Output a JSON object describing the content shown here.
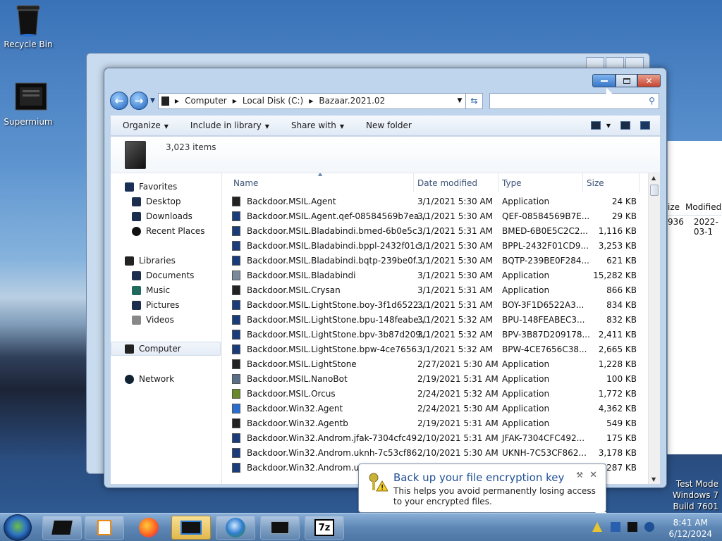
{
  "desktop": {
    "icons": [
      {
        "label": "Recycle Bin",
        "icon": "recycle-bin-icon"
      },
      {
        "label": "Supermium",
        "icon": "supermium-icon"
      }
    ]
  },
  "background_window": {
    "header_cols": [
      "ize",
      "Modified"
    ],
    "row": [
      "936",
      "2022-03-1"
    ]
  },
  "window": {
    "caption_buttons": [
      "minimize",
      "maximize",
      "close"
    ],
    "address": {
      "crumbs": [
        "Computer",
        "Local Disk (C:)",
        "Bazaar.2021.02"
      ]
    },
    "search_placeholder": "",
    "toolbar": {
      "organize": "Organize",
      "include": "Include in library",
      "share": "Share with",
      "new_folder": "New folder"
    },
    "info": {
      "count": "3,023 items"
    },
    "nav": {
      "favorites": "Favorites",
      "desktop": "Desktop",
      "downloads": "Downloads",
      "recent": "Recent Places",
      "libraries": "Libraries",
      "documents": "Documents",
      "music": "Music",
      "pictures": "Pictures",
      "videos": "Videos",
      "computer": "Computer",
      "network": "Network"
    },
    "columns": {
      "name": "Name",
      "date": "Date modified",
      "type": "Type",
      "size": "Size"
    },
    "files": [
      {
        "name": "Backdoor.MSIL.Agent",
        "date": "3/1/2021 5:30 AM",
        "type": "Application",
        "size": "24 KB",
        "icon": "app"
      },
      {
        "name": "Backdoor.MSIL.Agent.qef-08584569b7ea...",
        "date": "3/1/2021 5:30 AM",
        "type": "QEF-08584569B7E...",
        "size": "29 KB",
        "icon": "file"
      },
      {
        "name": "Backdoor.MSIL.Bladabindi.bmed-6b0e5c...",
        "date": "3/1/2021 5:31 AM",
        "type": "BMED-6B0E5C2C2...",
        "size": "1,116 KB",
        "icon": "file"
      },
      {
        "name": "Backdoor.MSIL.Bladabindi.bppl-2432f01c...",
        "date": "3/1/2021 5:30 AM",
        "type": "BPPL-2432F01CD9...",
        "size": "3,253 KB",
        "icon": "file"
      },
      {
        "name": "Backdoor.MSIL.Bladabindi.bqtp-239be0f...",
        "date": "3/1/2021 5:30 AM",
        "type": "BQTP-239BE0F284...",
        "size": "621 KB",
        "icon": "file"
      },
      {
        "name": "Backdoor.MSIL.Bladabindi",
        "date": "3/1/2021 5:30 AM",
        "type": "Application",
        "size": "15,282 KB",
        "icon": "app2"
      },
      {
        "name": "Backdoor.MSIL.Crysan",
        "date": "3/1/2021 5:31 AM",
        "type": "Application",
        "size": "866 KB",
        "icon": "app"
      },
      {
        "name": "Backdoor.MSIL.LightStone.boy-3f1d6522...",
        "date": "3/1/2021 5:31 AM",
        "type": "BOY-3F1D6522A3...",
        "size": "834 KB",
        "icon": "file"
      },
      {
        "name": "Backdoor.MSIL.LightStone.bpu-148feabe...",
        "date": "3/1/2021 5:32 AM",
        "type": "BPU-148FEABEC3...",
        "size": "832 KB",
        "icon": "file"
      },
      {
        "name": "Backdoor.MSIL.LightStone.bpv-3b87d209...",
        "date": "3/1/2021 5:32 AM",
        "type": "BPV-3B87D209178...",
        "size": "2,411 KB",
        "icon": "file"
      },
      {
        "name": "Backdoor.MSIL.LightStone.bpw-4ce7656...",
        "date": "3/1/2021 5:32 AM",
        "type": "BPW-4CE7656C38...",
        "size": "2,665 KB",
        "icon": "file"
      },
      {
        "name": "Backdoor.MSIL.LightStone",
        "date": "2/27/2021 5:30 AM",
        "type": "Application",
        "size": "1,228 KB",
        "icon": "app"
      },
      {
        "name": "Backdoor.MSIL.NanoBot",
        "date": "2/19/2021 5:31 AM",
        "type": "Application",
        "size": "100 KB",
        "icon": "app3"
      },
      {
        "name": "Backdoor.MSIL.Orcus",
        "date": "2/24/2021 5:32 AM",
        "type": "Application",
        "size": "1,772 KB",
        "icon": "app4"
      },
      {
        "name": "Backdoor.Win32.Agent",
        "date": "2/24/2021 5:30 AM",
        "type": "Application",
        "size": "4,362 KB",
        "icon": "app5"
      },
      {
        "name": "Backdoor.Win32.Agentb",
        "date": "2/19/2021 5:31 AM",
        "type": "Application",
        "size": "549 KB",
        "icon": "app"
      },
      {
        "name": "Backdoor.Win32.Androm.jfak-7304cfc49...",
        "date": "2/10/2021 5:31 AM",
        "type": "JFAK-7304CFC492...",
        "size": "175 KB",
        "icon": "file"
      },
      {
        "name": "Backdoor.Win32.Androm.uknh-7c53cf86...",
        "date": "2/10/2021 5:30 AM",
        "type": "UKNH-7C53CF862...",
        "size": "3,178 KB",
        "icon": "file"
      },
      {
        "name": "Backdoor.Win32.Androm.uko",
        "date": "",
        "type": "",
        "size": "287 KB",
        "icon": "file"
      }
    ]
  },
  "balloon": {
    "title": "Back up your file encryption key",
    "body": "This helps you avoid permanently losing access to your encrypted files."
  },
  "watermark": {
    "line1": "Test Mode",
    "line2": "Windows 7",
    "line3": "Build 7601"
  },
  "taskbar": {
    "apps": [
      "explorer-icon",
      "media-player-icon",
      "firefox-icon",
      "windows-explorer-active-icon",
      "globe-browser-icon",
      "display-app-icon",
      "7zip-icon"
    ],
    "sevenzip_label": "7z",
    "time": "8:41 AM",
    "date": "6/12/2024"
  }
}
